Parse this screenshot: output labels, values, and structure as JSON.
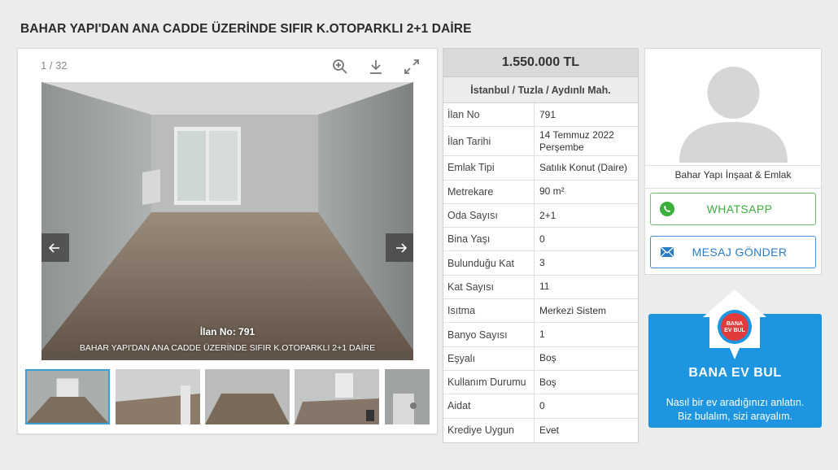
{
  "page_title": "BAHAR YAPI'DAN ANA CADDE ÜZERİNDE SIFIR K.OTOPARKLI 2+1 DAİRE",
  "gallery": {
    "counter": "1 / 32",
    "caption_no": "İlan No: 791",
    "caption_title": "BAHAR YAPI'DAN ANA CADDE ÜZERİNDE SIFIR K.OTOPARKLI 2+1 DAİRE",
    "tools": [
      "zoom-in-icon",
      "download-icon",
      "fullscreen-icon"
    ],
    "thumbnail_count_visible": 5,
    "active_thumbnail": 1
  },
  "listing": {
    "price": "1.550.000 TL",
    "location": "İstanbul / Tuzla / Aydınlı Mah.",
    "fields": [
      {
        "label": "İlan No",
        "value": "791"
      },
      {
        "label": "İlan Tarihi",
        "value": "14 Temmuz 2022\nPerşembe"
      },
      {
        "label": "Emlak Tipi",
        "value": "Satılık Konut (Daire)"
      },
      {
        "label": "Metrekare",
        "value": "90 m²"
      },
      {
        "label": "Oda Sayısı",
        "value": "2+1"
      },
      {
        "label": "Bina Yaşı",
        "value": "0"
      },
      {
        "label": "Bulunduğu Kat",
        "value": "3"
      },
      {
        "label": "Kat Sayısı",
        "value": "11"
      },
      {
        "label": "Isıtma",
        "value": "Merkezi Sistem"
      },
      {
        "label": "Banyo Sayısı",
        "value": "1"
      },
      {
        "label": "Eşyalı",
        "value": "Boş"
      },
      {
        "label": "Kullanım Durumu",
        "value": "Boş"
      },
      {
        "label": "Aidat",
        "value": "0"
      },
      {
        "label": "Krediye Uygun",
        "value": "Evet"
      }
    ]
  },
  "agent": {
    "name": "Bahar Yapı İnşaat & Emlak",
    "whatsapp_label": "WHATSAPP",
    "message_label": "MESAJ GÖNDER",
    "colors": {
      "whatsapp": "#3aaf3c",
      "message": "#2a7cc5"
    }
  },
  "promo": {
    "badge_text": "BANA EV BUL",
    "title": "BANA EV BUL",
    "text_line1": "Nasıl bir ev aradığınızı anlatın.",
    "text_line2": "Biz bulalım, sizi arayalım.",
    "color": "#1e95e0"
  }
}
